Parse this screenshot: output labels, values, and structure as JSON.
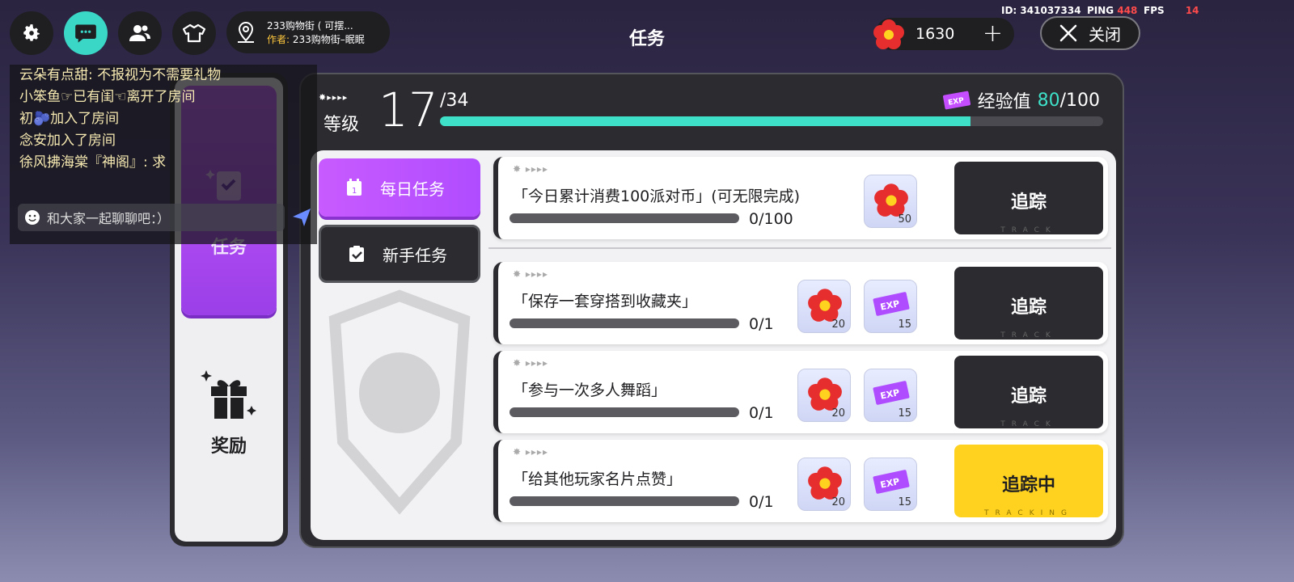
{
  "hud": {
    "id_label": "ID:",
    "id_value": "341037334",
    "ping_label": "PING",
    "ping_value": "448",
    "fps_label": "FPS",
    "fps_value": "14"
  },
  "topbar": {
    "buttons": [
      {
        "icon": "gear-icon"
      },
      {
        "icon": "chat-icon"
      },
      {
        "icon": "friends-icon"
      },
      {
        "icon": "outfit-icon"
      }
    ],
    "room": {
      "name": "233购物街 ( 可摆...",
      "author_label": "作者:",
      "author": "233购物街–眠眠",
      "icon": "location-pin-icon"
    },
    "title": "任务",
    "currency": {
      "value": "1630",
      "icon": "flower-coin-icon"
    },
    "close_label": "关闭"
  },
  "sidebar": {
    "tabs": [
      {
        "label": "任务",
        "icon": "task-clipboard-icon"
      },
      {
        "label": "奖励",
        "icon": "gift-icon"
      }
    ]
  },
  "level": {
    "label": "等级",
    "value": "17",
    "max": "/34",
    "xp_label": "经验值",
    "xp_current": "80",
    "xp_max": "/100",
    "xp_fraction": 0.8
  },
  "categories": [
    {
      "label": "每日任务",
      "icon": "calendar-icon"
    },
    {
      "label": "新手任务",
      "icon": "clipboard-check-icon"
    }
  ],
  "tasks": [
    {
      "name": "「今日累计消费100派对币」(可无限完成)",
      "progress": "0/100",
      "progress_fraction": 0,
      "rewards": [
        {
          "icon": "flower-coin-icon",
          "qty": "50"
        }
      ],
      "button": "追踪",
      "button_sub": "TRACK",
      "active": false
    },
    {
      "name": "「保存一套穿搭到收藏夹」",
      "progress": "0/1",
      "progress_fraction": 0,
      "rewards": [
        {
          "icon": "flower-coin-icon",
          "qty": "20"
        },
        {
          "icon": "exp-ticket-icon",
          "qty": "15"
        }
      ],
      "button": "追踪",
      "button_sub": "TRACK",
      "active": false
    },
    {
      "name": "「参与一次多人舞蹈」",
      "progress": "0/1",
      "progress_fraction": 0,
      "rewards": [
        {
          "icon": "flower-coin-icon",
          "qty": "20"
        },
        {
          "icon": "exp-ticket-icon",
          "qty": "15"
        }
      ],
      "button": "追踪",
      "button_sub": "TRACK",
      "active": false
    },
    {
      "name": "「给其他玩家名片点赞」",
      "progress": "0/1",
      "progress_fraction": 0,
      "rewards": [
        {
          "icon": "flower-coin-icon",
          "qty": "20"
        },
        {
          "icon": "exp-ticket-icon",
          "qty": "15"
        }
      ],
      "button": "追踪中",
      "button_sub": "TRACKING",
      "active": true
    }
  ],
  "chat": {
    "messages": [
      "云朵有点甜: 不报视为不需要礼物",
      "小笨鱼☞已有闺☜离开了房间",
      "初🫐加入了房间",
      "念安加入了房间",
      "徐风拂海棠『神阁』: 求"
    ],
    "placeholder": "和大家一起聊聊吧：）"
  },
  "colors": {
    "accent_teal": "#3ee0c8",
    "accent_purple": "#b04cff",
    "tracking_yellow": "#ffd21f",
    "dark": "#2b2b30"
  }
}
